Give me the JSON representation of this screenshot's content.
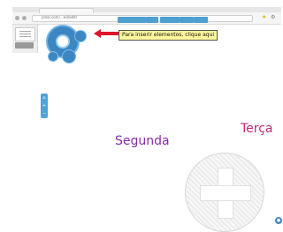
{
  "browser": {
    "url": "prezi.com/...ed/edit/",
    "tab_label": "",
    "star_icon": "star-icon",
    "wrench_icon": "wrench-icon"
  },
  "toolbar": {
    "items": [
      "",
      "",
      "",
      "",
      ""
    ]
  },
  "left_panel": {
    "add_label": ""
  },
  "bubble_menu": {
    "labels": [
      "",
      "",
      ""
    ]
  },
  "tooltip": {
    "text": "Para inserir elementos, clique aqui"
  },
  "canvas": {
    "word1": "Segunda",
    "word2": "Terça"
  },
  "colors": {
    "accent": "#3c87c2",
    "arrow": "#e0142c",
    "tooltip_bg": "#fff79c",
    "segunda": "#8a2ba6",
    "terca": "#c0287a"
  }
}
